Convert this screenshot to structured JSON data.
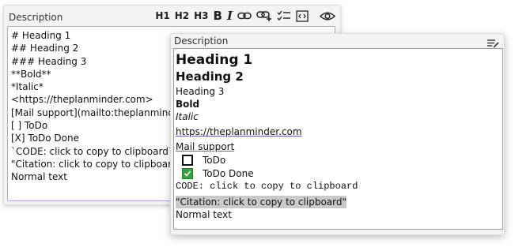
{
  "editor": {
    "label": "Description",
    "toolbar": {
      "h1": "H1",
      "h2": "H2",
      "h3": "H3",
      "bold": "B",
      "italic": "I"
    },
    "lines": [
      "# Heading 1",
      "## Heading 2",
      "### Heading 3",
      "**Bold**",
      "*Italic*",
      "<https://theplanminder.com>",
      "[Mail support](mailto:theplanminder@gmail.com)",
      "[ ] ToDo",
      "[X] ToDo Done",
      "`CODE: click to copy to clipboard`",
      "\"Citation: click to copy to clipboard\"",
      "Normal text"
    ]
  },
  "preview": {
    "label": "Description",
    "heading1": "Heading 1",
    "heading2": "Heading 2",
    "heading3": "Heading 3",
    "bold": "Bold",
    "italic": "Italic",
    "url": "https://theplanminder.com",
    "mail_link": "Mail support",
    "todo": "ToDo",
    "todo_done": "ToDo Done",
    "code": "CODE: click to copy to clipboard",
    "citation": "\"Citation: click to copy to clipboard\"",
    "normal": "Normal text"
  },
  "icons": {
    "toolbar": [
      "heading1",
      "heading2",
      "heading3",
      "bold",
      "italic",
      "link",
      "add-link",
      "checklist",
      "code-block",
      "preview-eye"
    ],
    "preview_header": "list-edit"
  },
  "colors": {
    "editor_focus_border": "#b4a2e0",
    "checkbox_done": "#33a23f",
    "citation_highlight": "#c9c9c9"
  }
}
